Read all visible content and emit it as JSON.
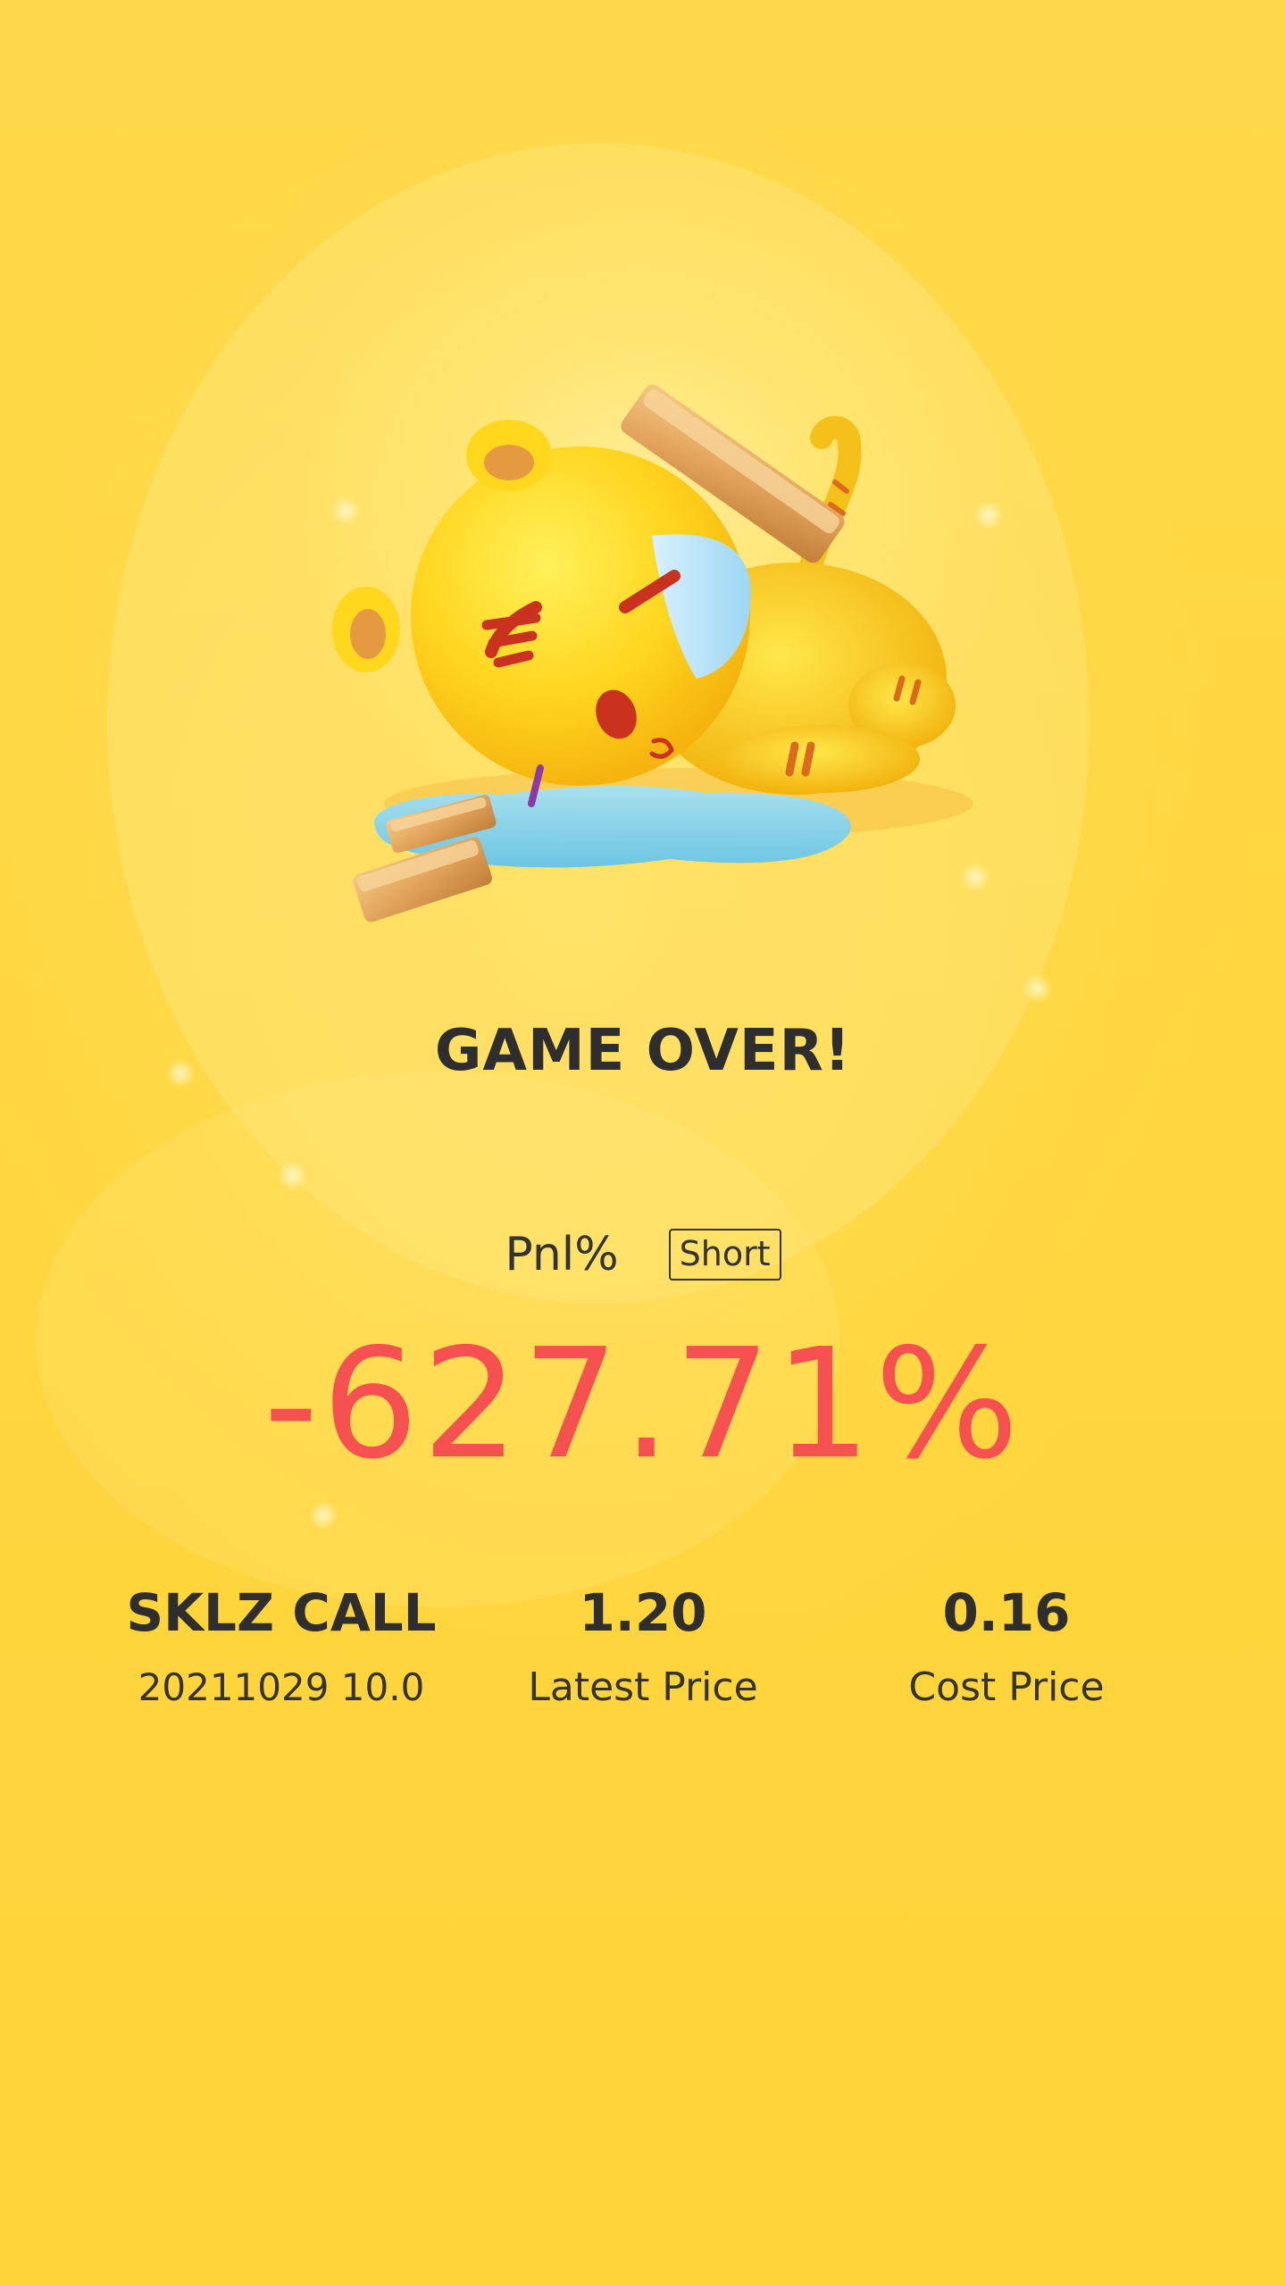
{
  "result": {
    "title": "GAME OVER!",
    "pnl_label": "Pnl%",
    "side": "Short",
    "pnl_value": "-627.71%",
    "pnl_color": "#F55151"
  },
  "stats": {
    "symbol": "SKLZ CALL",
    "contract": "20211029 10.0",
    "latest_price_value": "1.20",
    "latest_price_label": "Latest Price",
    "cost_price_value": "0.16",
    "cost_price_label": "Cost Price"
  },
  "illustration": {
    "icon": "fallen-tiger-mascot-with-gold-bars-icon"
  },
  "colors": {
    "background": "#FDD53A",
    "text": "#2E2E2E",
    "loss": "#F55151"
  }
}
